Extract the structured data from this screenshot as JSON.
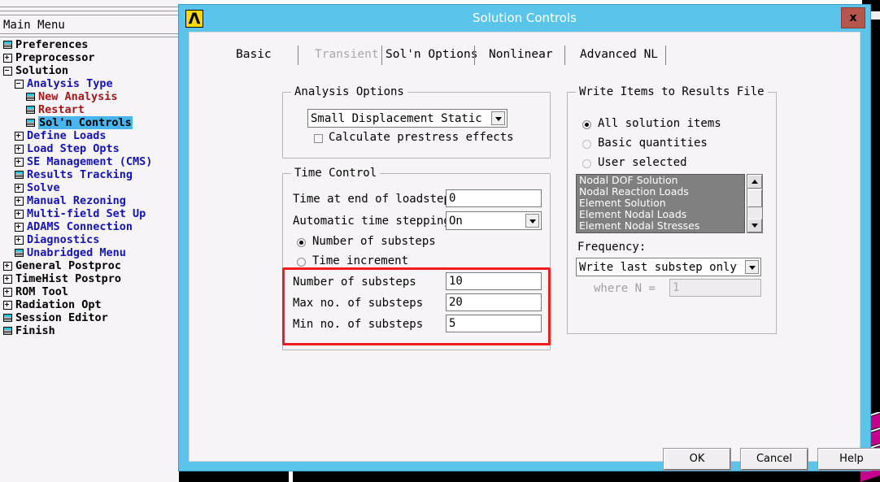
{
  "app": {
    "menu_title": "Main Menu",
    "icon": "ansys-logo-icon",
    "icon_glyph": "Λ"
  },
  "tree": {
    "items": [
      {
        "label": "Preferences",
        "indent": 0,
        "marker": "leaf",
        "color": "black"
      },
      {
        "label": "Preprocessor",
        "indent": 0,
        "marker": "plus",
        "color": "black"
      },
      {
        "label": "Solution",
        "indent": 0,
        "marker": "minus",
        "color": "black"
      },
      {
        "label": "Analysis Type",
        "indent": 1,
        "marker": "minus",
        "color": "blue"
      },
      {
        "label": "New Analysis",
        "indent": 2,
        "marker": "leaf",
        "color": "red"
      },
      {
        "label": "Restart",
        "indent": 2,
        "marker": "leaf",
        "color": "red"
      },
      {
        "label": "Sol'n Controls",
        "indent": 2,
        "marker": "leaf",
        "color": "blue",
        "selected": true
      },
      {
        "label": "Define Loads",
        "indent": 1,
        "marker": "plus",
        "color": "blue"
      },
      {
        "label": "Load Step Opts",
        "indent": 1,
        "marker": "plus",
        "color": "blue"
      },
      {
        "label": "SE Management (CMS)",
        "indent": 1,
        "marker": "plus",
        "color": "blue"
      },
      {
        "label": "Results Tracking",
        "indent": 1,
        "marker": "leaf",
        "color": "blue"
      },
      {
        "label": "Solve",
        "indent": 1,
        "marker": "plus",
        "color": "blue"
      },
      {
        "label": "Manual Rezoning",
        "indent": 1,
        "marker": "plus",
        "color": "blue"
      },
      {
        "label": "Multi-field Set Up",
        "indent": 1,
        "marker": "plus",
        "color": "blue"
      },
      {
        "label": "ADAMS Connection",
        "indent": 1,
        "marker": "plus",
        "color": "blue"
      },
      {
        "label": "Diagnostics",
        "indent": 1,
        "marker": "plus",
        "color": "blue"
      },
      {
        "label": "Unabridged Menu",
        "indent": 1,
        "marker": "leaf",
        "color": "blue"
      },
      {
        "label": "General Postproc",
        "indent": 0,
        "marker": "plus",
        "color": "black"
      },
      {
        "label": "TimeHist Postpro",
        "indent": 0,
        "marker": "plus",
        "color": "black"
      },
      {
        "label": "ROM Tool",
        "indent": 0,
        "marker": "plus",
        "color": "black"
      },
      {
        "label": "Radiation Opt",
        "indent": 0,
        "marker": "plus",
        "color": "black"
      },
      {
        "label": "Session Editor",
        "indent": 0,
        "marker": "leaf",
        "color": "black"
      },
      {
        "label": "Finish",
        "indent": 0,
        "marker": "leaf",
        "color": "black"
      }
    ]
  },
  "dialog": {
    "title": "Solution Controls",
    "close_label": "x",
    "tabs": [
      {
        "label": "Basic",
        "state": "active"
      },
      {
        "label": "Transient",
        "state": "disabled"
      },
      {
        "label": "Sol'n Options",
        "state": "normal"
      },
      {
        "label": "Nonlinear",
        "state": "normal"
      },
      {
        "label": "Advanced NL",
        "state": "normal"
      }
    ],
    "analysis_options": {
      "title": "Analysis Options",
      "analysis_type_value": "Small Displacement Static",
      "prestress_label": "Calculate prestress effects",
      "prestress_checked": false
    },
    "time_control": {
      "title": "Time Control",
      "time_end_label": "Time at end of loadstep",
      "time_end_value": "0",
      "auto_time_label": "Automatic time stepping",
      "auto_time_value": "On",
      "radio_substeps_label": "Number of substeps",
      "radio_substeps_selected": true,
      "radio_timeinc_label": "Time increment",
      "radio_timeinc_selected": false,
      "number_substeps_label": "Number of substeps",
      "number_substeps_value": "10",
      "max_substeps_label": "Max no. of substeps",
      "max_substeps_value": "20",
      "min_substeps_label": "Min no. of substeps",
      "min_substeps_value": "5"
    },
    "write_items": {
      "title": "Write Items to Results File",
      "options": [
        {
          "label": "All solution items",
          "selected": true
        },
        {
          "label": "Basic quantities",
          "selected": false
        },
        {
          "label": "User selected",
          "selected": false
        }
      ],
      "list_items": [
        "Nodal DOF Solution",
        "Nodal Reaction Loads",
        "Element Solution",
        "Element Nodal Loads",
        "Element Nodal Stresses"
      ],
      "frequency_label": "Frequency:",
      "frequency_value": "Write last substep only",
      "where_n_label": "where N =",
      "where_n_value": "1"
    },
    "buttons": {
      "ok": "OK",
      "cancel": "Cancel",
      "help": "Help"
    }
  },
  "annotation": {
    "highlight_color": "#f21b1b"
  }
}
